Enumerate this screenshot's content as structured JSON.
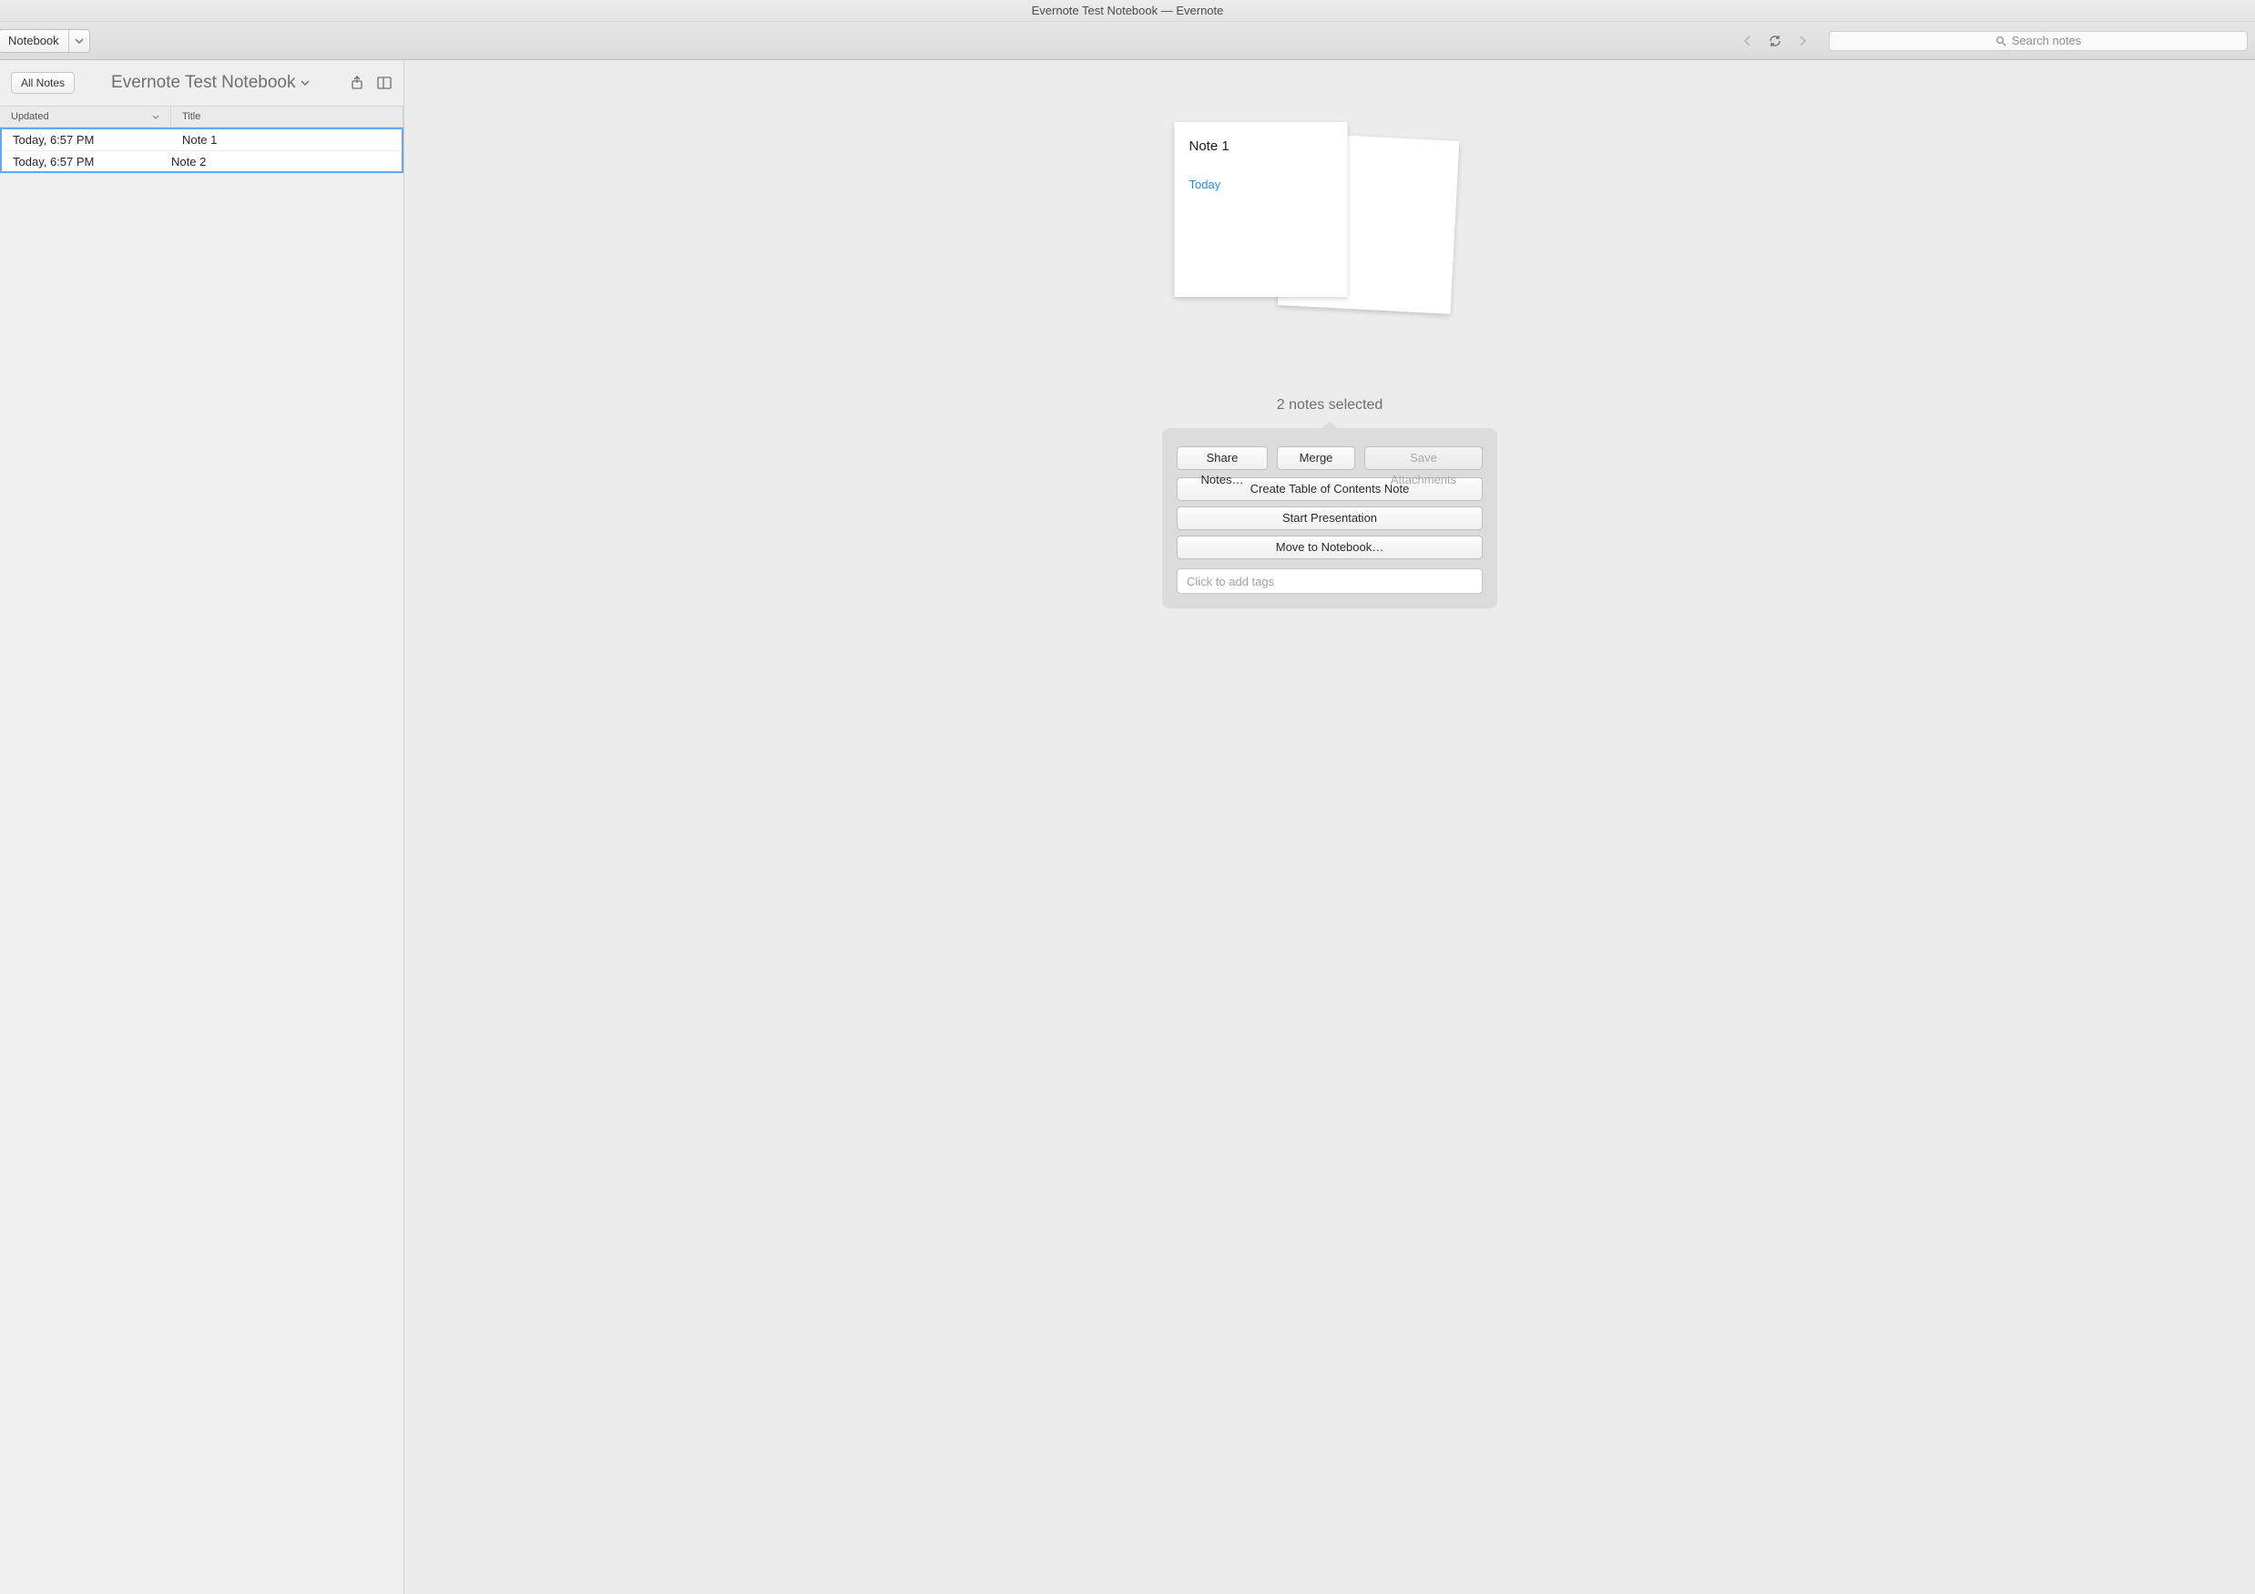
{
  "window": {
    "title": "Evernote Test Notebook — Evernote"
  },
  "toolbar": {
    "notebook_label": "Notebook",
    "search_placeholder": "Search notes"
  },
  "sidebar": {
    "all_notes_label": "All Notes",
    "notebook_title": "Evernote Test Notebook",
    "columns": {
      "updated": "Updated",
      "title": "Title"
    },
    "rows": [
      {
        "updated": "Today, 6:57 PM",
        "title": "Note 1"
      },
      {
        "updated": "Today, 6:57 PM",
        "title": "Note 2"
      }
    ]
  },
  "main": {
    "preview_card": {
      "title": "Note 1",
      "date": "Today"
    },
    "selected_text": "2 notes selected",
    "actions": {
      "share": "Share Notes…",
      "merge": "Merge",
      "save_attachments": "Save Attachments",
      "toc": "Create Table of Contents Note",
      "presentation": "Start Presentation",
      "move": "Move to Notebook…",
      "tags_placeholder": "Click to add tags"
    }
  }
}
